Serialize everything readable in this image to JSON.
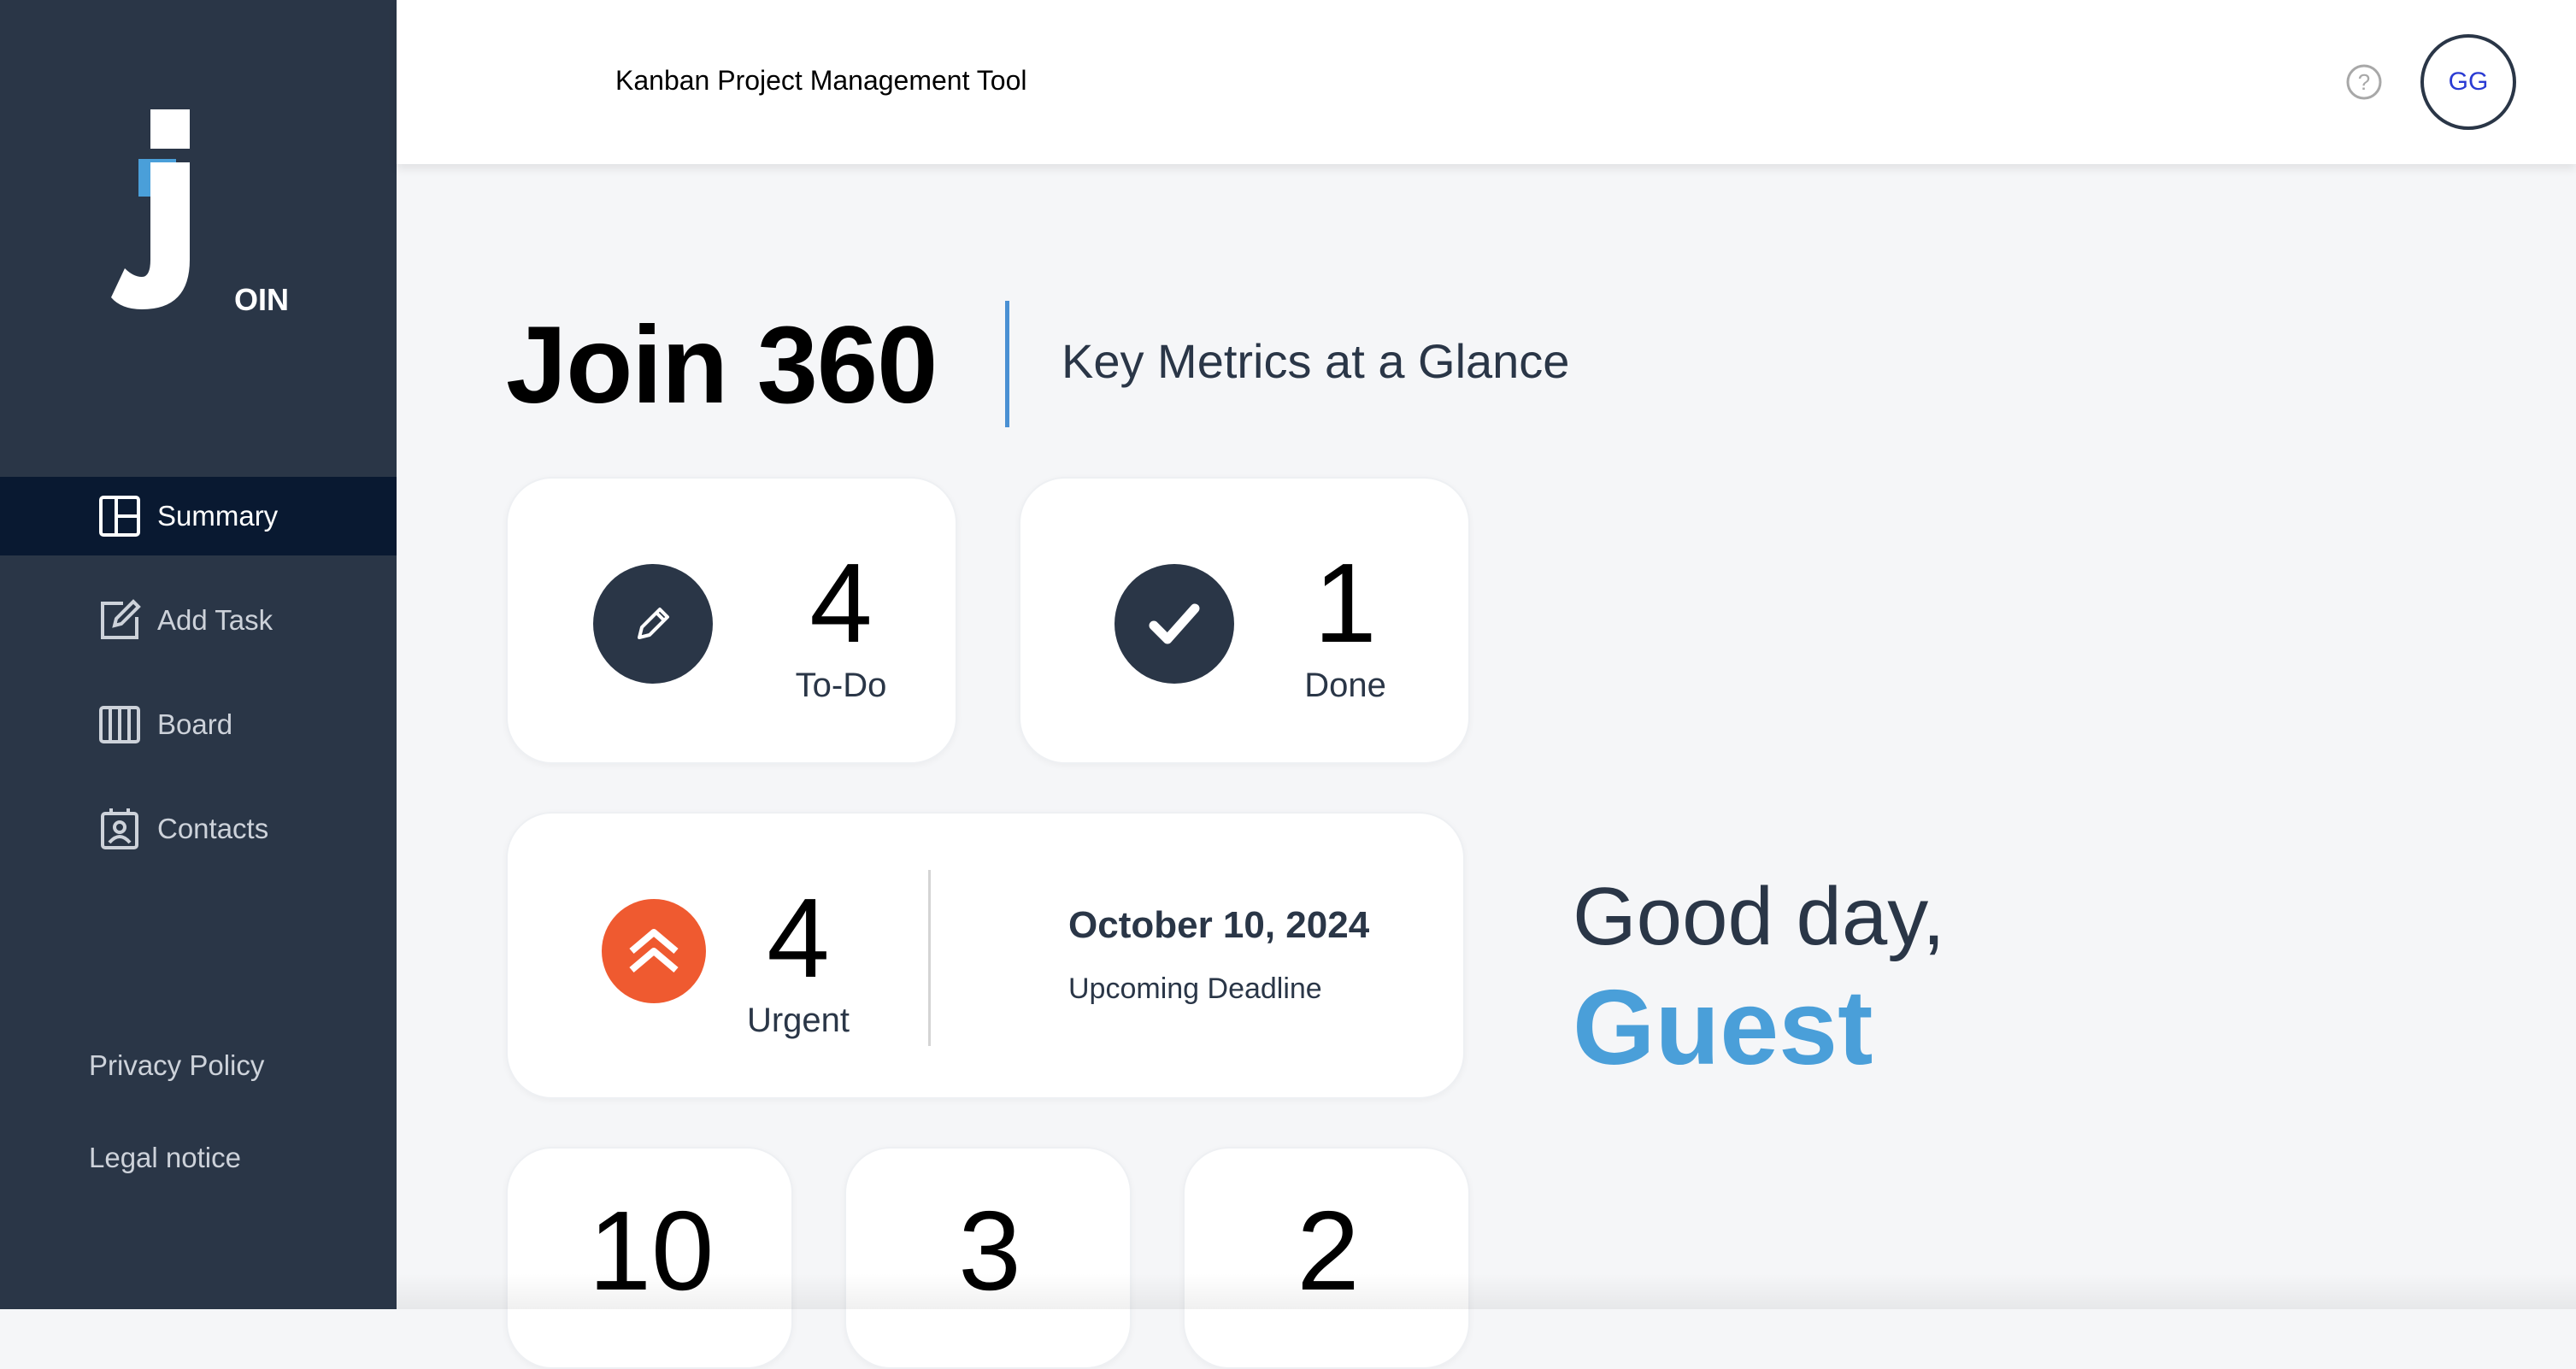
{
  "sidebar": {
    "logo_text": "OIN",
    "items": [
      {
        "label": "Summary",
        "active": true,
        "icon": "summary-icon"
      },
      {
        "label": "Add Task",
        "active": false,
        "icon": "add-task-icon"
      },
      {
        "label": "Board",
        "active": false,
        "icon": "board-icon"
      },
      {
        "label": "Contacts",
        "active": false,
        "icon": "contacts-icon"
      }
    ],
    "footer": {
      "privacy": "Privacy Policy",
      "legal": "Legal notice"
    }
  },
  "header": {
    "title": "Kanban Project Management Tool",
    "help_icon": "help-icon",
    "avatar_initials": "GG"
  },
  "main": {
    "title": "Join 360",
    "subtitle": "Key Metrics at a Glance",
    "todo": {
      "count": "4",
      "label": "To-Do"
    },
    "done": {
      "count": "1",
      "label": "Done"
    },
    "urgent": {
      "count": "4",
      "label": "Urgent",
      "deadline_date": "October 10, 2024",
      "deadline_label": "Upcoming Deadline"
    },
    "bottom_counts": [
      "10",
      "3",
      "2"
    ],
    "greeting": "Good day,",
    "greeting_name": "Guest"
  },
  "colors": {
    "sidebar_bg": "#2a3647",
    "active_nav_bg": "#091931",
    "accent_blue": "#4a9fd9",
    "urgent_orange": "#ef5a30",
    "logo_blue": "#4a9fd9"
  }
}
